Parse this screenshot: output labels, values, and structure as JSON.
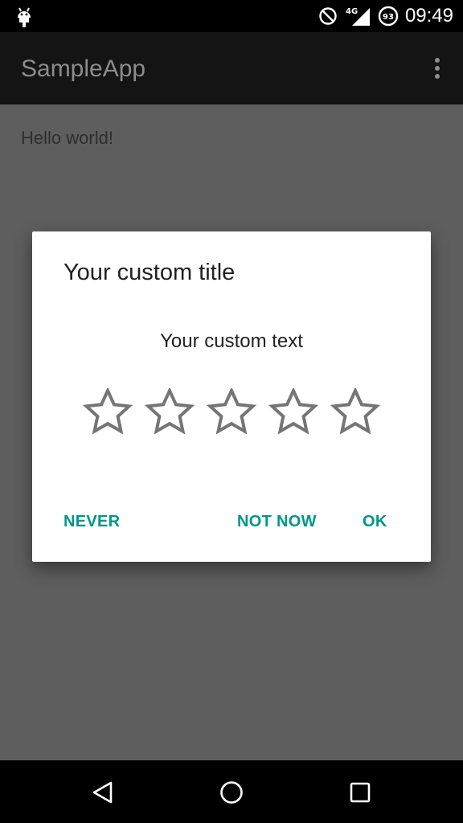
{
  "status_bar": {
    "time": "09:49",
    "network": "4G",
    "battery": "93",
    "icons": [
      "android-icon",
      "do-not-disturb-icon",
      "signal-icon",
      "battery-icon"
    ]
  },
  "app_bar": {
    "title": "SampleApp",
    "menu_icon": "overflow-menu-icon"
  },
  "content": {
    "text": "Hello world!"
  },
  "dialog": {
    "title": "Your custom title",
    "message": "Your custom text",
    "rating": {
      "value": 0,
      "max": 5
    },
    "buttons": {
      "never": "NEVER",
      "not_now": "NOT NOW",
      "ok": "OK"
    },
    "accent_color": "#009688"
  },
  "nav_bar": {
    "icons": [
      "back-icon",
      "home-icon",
      "recents-icon"
    ]
  }
}
